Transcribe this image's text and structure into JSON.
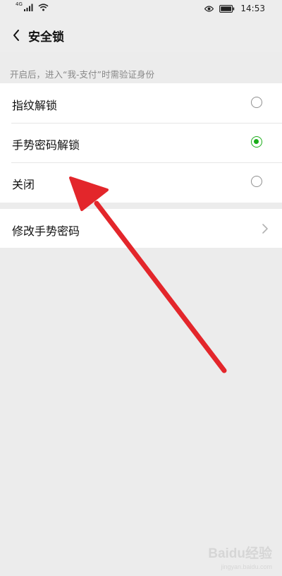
{
  "status_bar": {
    "network": "4G",
    "time": "14:53"
  },
  "header": {
    "title": "安全锁"
  },
  "hint": "开启后，进入“我-支付”时需验证身份",
  "lock_options": [
    {
      "label": "指纹解锁",
      "selected": false
    },
    {
      "label": "手势密码解锁",
      "selected": true
    },
    {
      "label": "关闭",
      "selected": false
    }
  ],
  "change_gesture": {
    "label": "修改手势密码"
  },
  "watermark": {
    "logo_text": "Baidu经验",
    "sub_text": "jingyan.baidu.com"
  },
  "colors": {
    "accent": "#1aad19",
    "annotation_arrow": "#e3262b",
    "background": "#ececec"
  }
}
